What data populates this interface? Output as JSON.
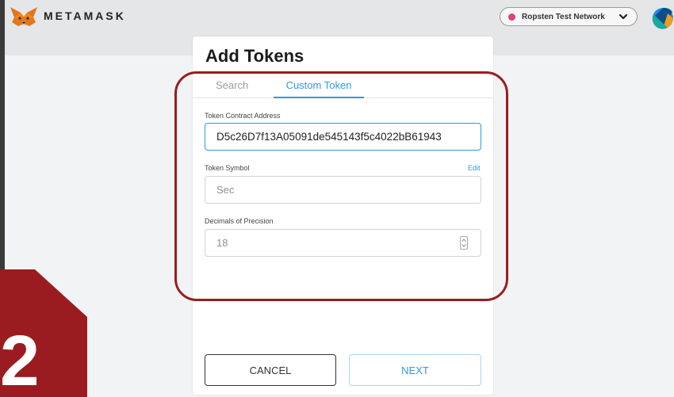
{
  "header": {
    "brand": "METAMASK",
    "network_label": "Ropsten Test Network",
    "network_color": "#e83e72"
  },
  "dialog": {
    "title": "Add Tokens",
    "tabs": [
      {
        "label": "Search",
        "active": false
      },
      {
        "label": "Custom Token",
        "active": true
      }
    ],
    "contract_address": {
      "label": "Token Contract Address",
      "value": "D5c26D7f13A05091de545143f5c4022bB61943"
    },
    "token_symbol": {
      "label": "Token Symbol",
      "edit_label": "Edit",
      "value": "Sec"
    },
    "decimals": {
      "label": "Decimals of Precision",
      "value": "18"
    },
    "cancel_label": "CANCEL",
    "next_label": "NEXT"
  },
  "overlay": {
    "step_number": "2",
    "highlight_color": "#9a1c20"
  },
  "icons": [
    "metamask-fox-logo",
    "chevron-down-icon",
    "account-avatar-icon",
    "number-stepper-icon"
  ]
}
